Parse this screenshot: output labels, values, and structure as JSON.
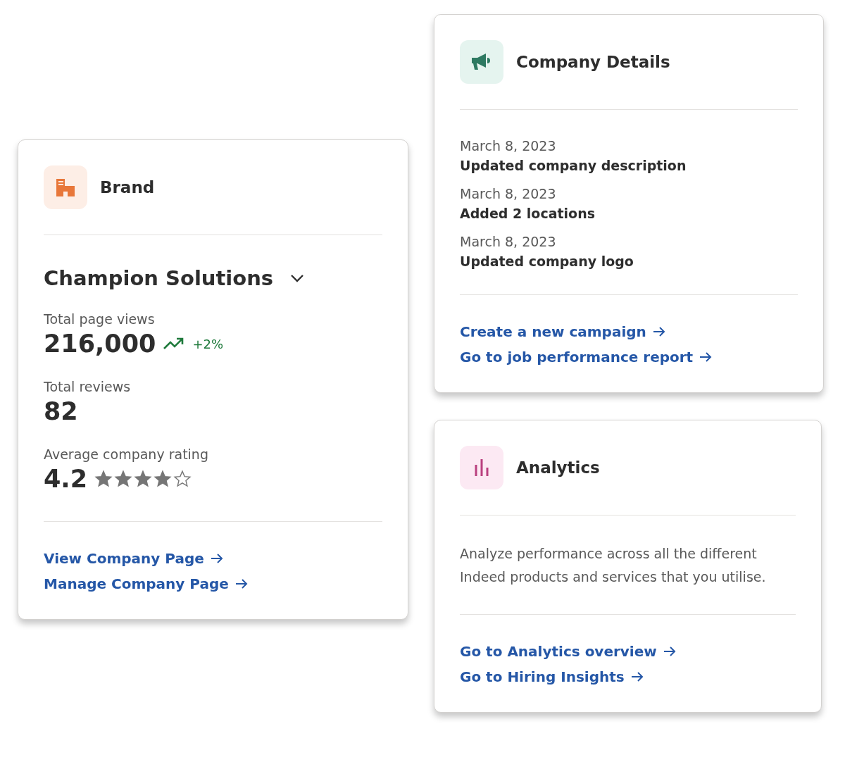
{
  "brand_card": {
    "title": "Brand",
    "company": "Champion Solutions",
    "metrics": [
      {
        "label": "Total page views",
        "value": "216,000",
        "trend": "+2%"
      },
      {
        "label": "Total reviews",
        "value": "82"
      }
    ],
    "rating": {
      "label": "Average company rating",
      "value": "4.2",
      "stars": 4
    },
    "links": [
      "View Company Page",
      "Manage Company Page"
    ]
  },
  "details_card": {
    "title": "Company Details",
    "activity": [
      {
        "date": "March 8, 2023",
        "text": "Updated company description"
      },
      {
        "date": "March 8, 2023",
        "text": "Added 2 locations"
      },
      {
        "date": "March 8, 2023",
        "text": "Updated company logo"
      }
    ],
    "links": [
      "Create a new campaign",
      "Go to job performance report"
    ]
  },
  "analytics_card": {
    "title": "Analytics",
    "description": "Analyze performance across all the different Indeed products and services that you utilise.",
    "links": [
      "Go to Analytics overview",
      "Go to Hiring Insights"
    ]
  }
}
